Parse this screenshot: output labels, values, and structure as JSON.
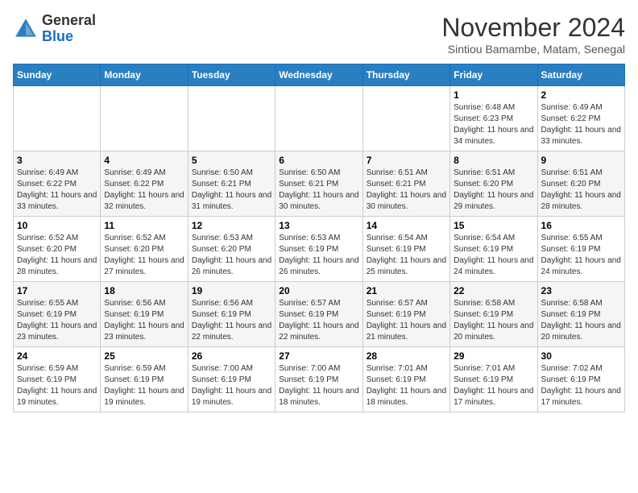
{
  "header": {
    "logo_general": "General",
    "logo_blue": "Blue",
    "month_title": "November 2024",
    "location": "Sintiou Bamambe, Matam, Senegal"
  },
  "weekdays": [
    "Sunday",
    "Monday",
    "Tuesday",
    "Wednesday",
    "Thursday",
    "Friday",
    "Saturday"
  ],
  "weeks": [
    [
      {
        "day": "",
        "info": ""
      },
      {
        "day": "",
        "info": ""
      },
      {
        "day": "",
        "info": ""
      },
      {
        "day": "",
        "info": ""
      },
      {
        "day": "",
        "info": ""
      },
      {
        "day": "1",
        "info": "Sunrise: 6:48 AM\nSunset: 6:23 PM\nDaylight: 11 hours and 34 minutes."
      },
      {
        "day": "2",
        "info": "Sunrise: 6:49 AM\nSunset: 6:22 PM\nDaylight: 11 hours and 33 minutes."
      }
    ],
    [
      {
        "day": "3",
        "info": "Sunrise: 6:49 AM\nSunset: 6:22 PM\nDaylight: 11 hours and 33 minutes."
      },
      {
        "day": "4",
        "info": "Sunrise: 6:49 AM\nSunset: 6:22 PM\nDaylight: 11 hours and 32 minutes."
      },
      {
        "day": "5",
        "info": "Sunrise: 6:50 AM\nSunset: 6:21 PM\nDaylight: 11 hours and 31 minutes."
      },
      {
        "day": "6",
        "info": "Sunrise: 6:50 AM\nSunset: 6:21 PM\nDaylight: 11 hours and 30 minutes."
      },
      {
        "day": "7",
        "info": "Sunrise: 6:51 AM\nSunset: 6:21 PM\nDaylight: 11 hours and 30 minutes."
      },
      {
        "day": "8",
        "info": "Sunrise: 6:51 AM\nSunset: 6:20 PM\nDaylight: 11 hours and 29 minutes."
      },
      {
        "day": "9",
        "info": "Sunrise: 6:51 AM\nSunset: 6:20 PM\nDaylight: 11 hours and 28 minutes."
      }
    ],
    [
      {
        "day": "10",
        "info": "Sunrise: 6:52 AM\nSunset: 6:20 PM\nDaylight: 11 hours and 28 minutes."
      },
      {
        "day": "11",
        "info": "Sunrise: 6:52 AM\nSunset: 6:20 PM\nDaylight: 11 hours and 27 minutes."
      },
      {
        "day": "12",
        "info": "Sunrise: 6:53 AM\nSunset: 6:20 PM\nDaylight: 11 hours and 26 minutes."
      },
      {
        "day": "13",
        "info": "Sunrise: 6:53 AM\nSunset: 6:19 PM\nDaylight: 11 hours and 26 minutes."
      },
      {
        "day": "14",
        "info": "Sunrise: 6:54 AM\nSunset: 6:19 PM\nDaylight: 11 hours and 25 minutes."
      },
      {
        "day": "15",
        "info": "Sunrise: 6:54 AM\nSunset: 6:19 PM\nDaylight: 11 hours and 24 minutes."
      },
      {
        "day": "16",
        "info": "Sunrise: 6:55 AM\nSunset: 6:19 PM\nDaylight: 11 hours and 24 minutes."
      }
    ],
    [
      {
        "day": "17",
        "info": "Sunrise: 6:55 AM\nSunset: 6:19 PM\nDaylight: 11 hours and 23 minutes."
      },
      {
        "day": "18",
        "info": "Sunrise: 6:56 AM\nSunset: 6:19 PM\nDaylight: 11 hours and 23 minutes."
      },
      {
        "day": "19",
        "info": "Sunrise: 6:56 AM\nSunset: 6:19 PM\nDaylight: 11 hours and 22 minutes."
      },
      {
        "day": "20",
        "info": "Sunrise: 6:57 AM\nSunset: 6:19 PM\nDaylight: 11 hours and 22 minutes."
      },
      {
        "day": "21",
        "info": "Sunrise: 6:57 AM\nSunset: 6:19 PM\nDaylight: 11 hours and 21 minutes."
      },
      {
        "day": "22",
        "info": "Sunrise: 6:58 AM\nSunset: 6:19 PM\nDaylight: 11 hours and 20 minutes."
      },
      {
        "day": "23",
        "info": "Sunrise: 6:58 AM\nSunset: 6:19 PM\nDaylight: 11 hours and 20 minutes."
      }
    ],
    [
      {
        "day": "24",
        "info": "Sunrise: 6:59 AM\nSunset: 6:19 PM\nDaylight: 11 hours and 19 minutes."
      },
      {
        "day": "25",
        "info": "Sunrise: 6:59 AM\nSunset: 6:19 PM\nDaylight: 11 hours and 19 minutes."
      },
      {
        "day": "26",
        "info": "Sunrise: 7:00 AM\nSunset: 6:19 PM\nDaylight: 11 hours and 19 minutes."
      },
      {
        "day": "27",
        "info": "Sunrise: 7:00 AM\nSunset: 6:19 PM\nDaylight: 11 hours and 18 minutes."
      },
      {
        "day": "28",
        "info": "Sunrise: 7:01 AM\nSunset: 6:19 PM\nDaylight: 11 hours and 18 minutes."
      },
      {
        "day": "29",
        "info": "Sunrise: 7:01 AM\nSunset: 6:19 PM\nDaylight: 11 hours and 17 minutes."
      },
      {
        "day": "30",
        "info": "Sunrise: 7:02 AM\nSunset: 6:19 PM\nDaylight: 11 hours and 17 minutes."
      }
    ]
  ]
}
